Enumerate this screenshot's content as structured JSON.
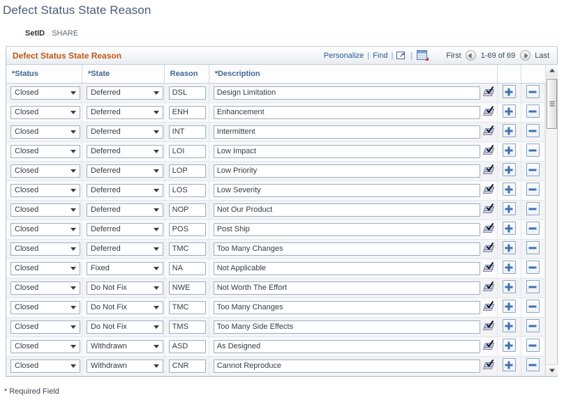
{
  "page": {
    "title": "Defect Status State Reason",
    "setid_label": "SetID",
    "setid_value": "SHARE",
    "required_note": "* Required Field"
  },
  "grid": {
    "header_title": "Defect Status State Reason",
    "links": {
      "personalize": "Personalize",
      "find": "Find",
      "sep1": "|",
      "sep2": "|",
      "sep3": "|",
      "expand_icon": "expand-window-icon",
      "download_icon": "grid-download-icon"
    },
    "pager": {
      "first": "First",
      "prev_icon": "prev-arrow-icon",
      "range": "1-69 of 69",
      "next_icon": "next-arrow-icon",
      "last": "Last"
    },
    "columns": [
      {
        "label": "*Status"
      },
      {
        "label": "*State"
      },
      {
        "label": "Reason"
      },
      {
        "label": "*Description"
      },
      {
        "label": ""
      },
      {
        "label": ""
      }
    ],
    "row_actions": {
      "add_label": "+",
      "delete_label": "-",
      "spellcheck_icon": "spell-check-icon"
    },
    "rows": [
      {
        "status": "Closed",
        "state": "Deferred",
        "reason": "DSL",
        "description": "Design Limitation"
      },
      {
        "status": "Closed",
        "state": "Deferred",
        "reason": "ENH",
        "description": "Enhancement"
      },
      {
        "status": "Closed",
        "state": "Deferred",
        "reason": "INT",
        "description": "Intermittent"
      },
      {
        "status": "Closed",
        "state": "Deferred",
        "reason": "LOI",
        "description": "Low Impact"
      },
      {
        "status": "Closed",
        "state": "Deferred",
        "reason": "LOP",
        "description": "Low Priority"
      },
      {
        "status": "Closed",
        "state": "Deferred",
        "reason": "LOS",
        "description": "Low Severity"
      },
      {
        "status": "Closed",
        "state": "Deferred",
        "reason": "NOP",
        "description": "Not Our Product"
      },
      {
        "status": "Closed",
        "state": "Deferred",
        "reason": "POS",
        "description": "Post Ship"
      },
      {
        "status": "Closed",
        "state": "Deferred",
        "reason": "TMC",
        "description": "Too Many Changes"
      },
      {
        "status": "Closed",
        "state": "Fixed",
        "reason": "NA",
        "description": "Not Applicable"
      },
      {
        "status": "Closed",
        "state": "Do Not Fix",
        "reason": "NWE",
        "description": "Not Worth The Effort"
      },
      {
        "status": "Closed",
        "state": "Do Not Fix",
        "reason": "TMC",
        "description": "Too Many Changes"
      },
      {
        "status": "Closed",
        "state": "Do Not Fix",
        "reason": "TMS",
        "description": "Too Many Side Effects"
      },
      {
        "status": "Closed",
        "state": "Withdrawn",
        "reason": "ASD",
        "description": "As Designed"
      },
      {
        "status": "Closed",
        "state": "Withdrawn",
        "reason": "CNR",
        "description": "Cannot Reproduce"
      }
    ]
  },
  "colors": {
    "title": "#4a5a78",
    "grid_header_text": "#c05a12",
    "link": "#2a5699",
    "column_header": "#3f6699"
  }
}
